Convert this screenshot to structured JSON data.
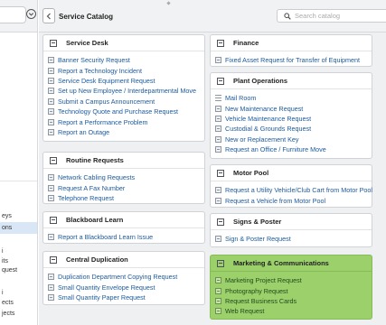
{
  "sidebar": {
    "items": [
      {
        "label": "eys",
        "selected": false
      },
      {
        "label": "ons",
        "selected": true
      },
      {
        "label": "i",
        "selected": false
      },
      {
        "label": "its",
        "selected": false
      },
      {
        "label": "quest",
        "selected": false
      },
      {
        "label": "i",
        "selected": false
      },
      {
        "label": "ects",
        "selected": false
      },
      {
        "label": "jects",
        "selected": false
      }
    ]
  },
  "header": {
    "title": "Service Catalog",
    "search_placeholder": "Search catalog"
  },
  "cards": {
    "service_desk": {
      "title": "Service Desk",
      "items": [
        "Banner Security Request",
        "Report a Technology Incident",
        "Service Desk Equipment Request",
        "Set up New Employee / Interdepartmental Move",
        "Submit a Campus Announcement",
        "Technology Quote and Purchase Request",
        "Report a Performance Problem",
        "Report an Outage"
      ]
    },
    "routine_requests": {
      "title": "Routine Requests",
      "items": [
        "Network Cabling Requests",
        "Request A Fax Number",
        "Telephone Request"
      ]
    },
    "blackboard_learn": {
      "title": "Blackboard Learn",
      "items": [
        "Report a Blackboard Learn Issue"
      ]
    },
    "central_duplication": {
      "title": "Central Duplication",
      "items": [
        "Duplication Department Copying Request",
        "Small Quantity Envelope Request",
        "Small Quantity Paper Request"
      ]
    },
    "finance": {
      "title": "Finance",
      "items": [
        "Fixed Asset Request for Transfer of Equipment"
      ]
    },
    "plant_operations": {
      "title": "Plant Operations",
      "items": [
        "Mail Room",
        "New Maintenance Request",
        "Vehicle Maintenance Request",
        "Custodial & Grounds Request",
        "New or Replacement Key",
        "Request an Office / Furniture Move"
      ]
    },
    "motor_pool": {
      "title": "Motor Pool",
      "items": [
        "Request a Utility Vehicle/Club Cart from Motor Pool",
        "Request a Vehicle from Motor Pool"
      ]
    },
    "signs_poster": {
      "title": "Signs & Poster",
      "items": [
        "Sign & Poster Request"
      ]
    },
    "marketing": {
      "title": "Marketing & Communications",
      "items": [
        "Marketing Project Request",
        "Photography Request",
        "Request Business Cards",
        "Web Request"
      ]
    }
  },
  "colors": {
    "link": "#1a5a9e",
    "highlight_card": "#9bd06b",
    "sidebar_selected": "#d8e6f5"
  }
}
